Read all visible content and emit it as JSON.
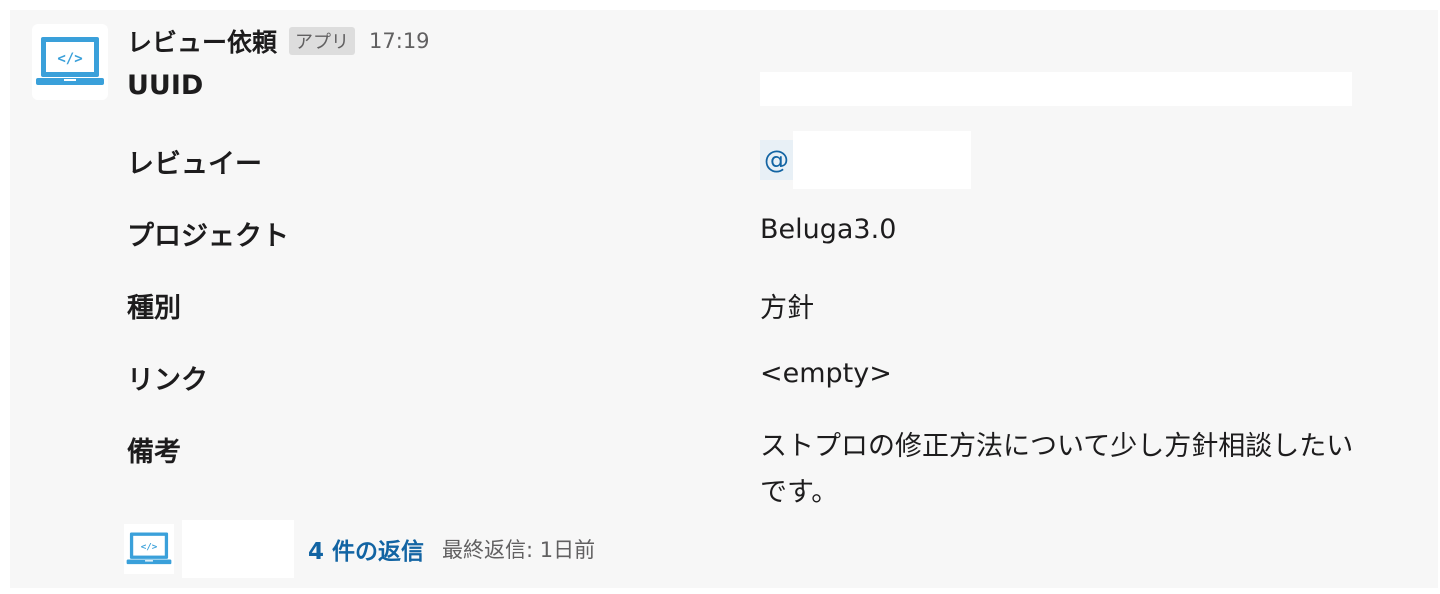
{
  "message": {
    "sender": "レビュー依頼",
    "app_badge": "アプリ",
    "timestamp": "17:19",
    "avatar_icon": "laptop-code-icon"
  },
  "fields": {
    "uuid": {
      "label": "UUID",
      "value": ""
    },
    "reviewee": {
      "label": "レビュイー",
      "mention_prefix": "@",
      "value": ""
    },
    "project": {
      "label": "プロジェクト",
      "value": "Beluga3.0"
    },
    "type": {
      "label": "種別",
      "value": "方針"
    },
    "link": {
      "label": "リンク",
      "value": "<empty>"
    },
    "note": {
      "label": "備考",
      "value": "ストプロの修正方法について少し方針相談したいです。"
    }
  },
  "thread": {
    "reply_count_label": "4 件の返信",
    "last_reply_label": "最終返信: 1日前",
    "avatar_icon": "laptop-code-icon"
  },
  "colors": {
    "background": "#f7f7f7",
    "link_blue": "#1264a3",
    "icon_blue": "#3aa0da",
    "muted_text": "#616061"
  }
}
